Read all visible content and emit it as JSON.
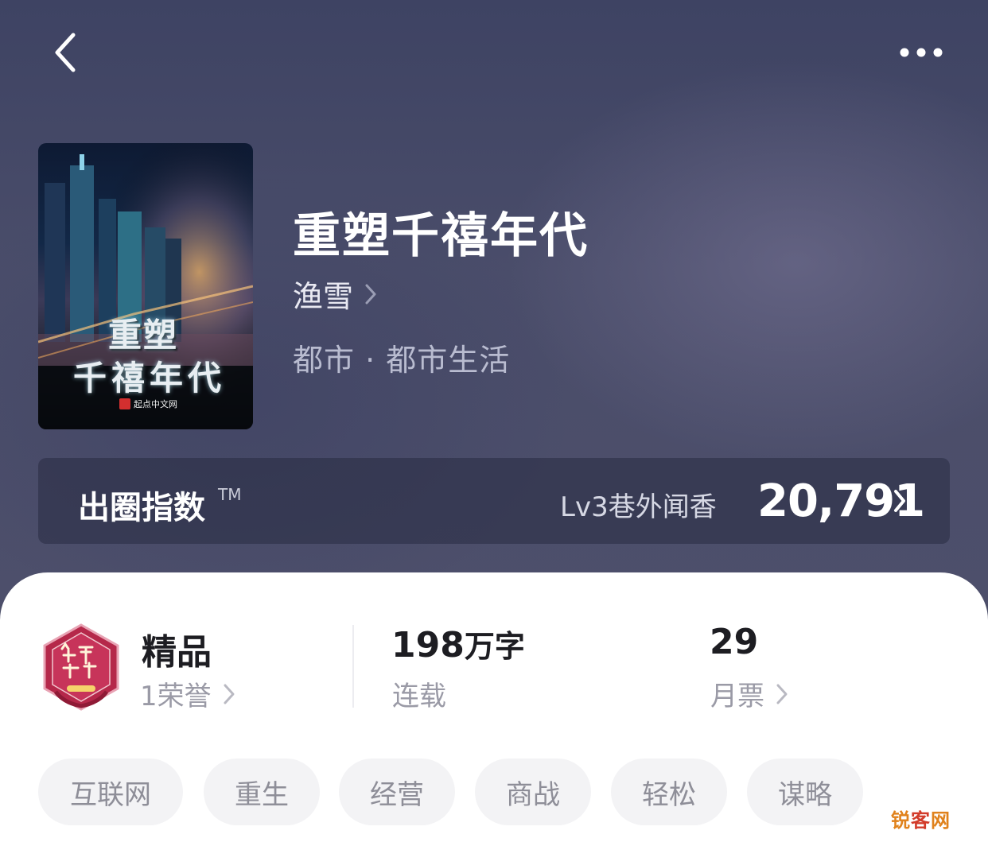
{
  "header": {
    "back_icon": "chevron-left-icon",
    "more_icon": "more-dots-icon"
  },
  "cover": {
    "title_line1": "重塑",
    "title_line2": "千禧年代",
    "publisher": "起点中文网"
  },
  "book": {
    "title": "重塑千禧年代",
    "author": "渔雪",
    "genre": "都市 · 都市生活"
  },
  "index_bar": {
    "label": "出圈指数",
    "tm": "TM",
    "level": "Lv3巷外闻香",
    "score": "20,791"
  },
  "stats": {
    "quality": {
      "title": "精品",
      "sub": "1荣誉"
    },
    "words": {
      "value": "198",
      "unit": "万字",
      "sub": "连载"
    },
    "votes": {
      "value": "29",
      "sub": "月票"
    }
  },
  "tags": [
    "互联网",
    "重生",
    "经营",
    "商战",
    "轻松",
    "谋略"
  ],
  "watermark": {
    "part1": "锐",
    "part2": "客",
    "part3": "网"
  },
  "colors": {
    "hero_bg": "#4b4e68",
    "card_bg": "#ffffff",
    "tag_bg": "#f3f3f5",
    "badge_red": "#b5284a"
  }
}
